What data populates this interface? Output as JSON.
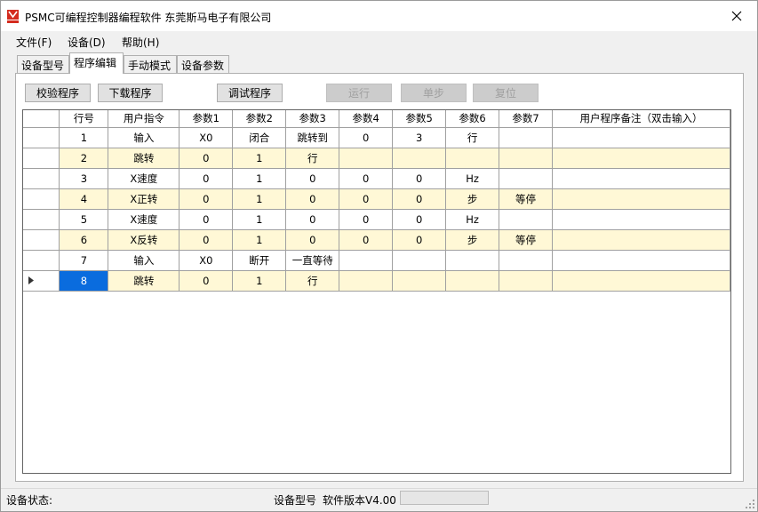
{
  "window": {
    "title": "PSMC可编程控制器编程软件 东莞斯马电子有限公司",
    "accent": "#d42b1e"
  },
  "menu": [
    {
      "label": "文件(F)"
    },
    {
      "label": "设备(D)"
    },
    {
      "label": "帮助(H)"
    }
  ],
  "tabs": [
    {
      "label": "设备型号"
    },
    {
      "label": "程序编辑"
    },
    {
      "label": "手动模式"
    },
    {
      "label": "设备参数"
    }
  ],
  "toolbar": {
    "verify": "校验程序",
    "download": "下载程序",
    "debug": "调试程序",
    "run": "运行",
    "step": "单步",
    "reset": "复位"
  },
  "grid": {
    "headers": [
      "行号",
      "用户指令",
      "参数1",
      "参数2",
      "参数3",
      "参数4",
      "参数5",
      "参数6",
      "参数7",
      "用户程序备注（双击输入）"
    ],
    "rows": [
      [
        "1",
        "输入",
        "X0",
        "闭合",
        "跳转到",
        "0",
        "3",
        "行",
        "",
        ""
      ],
      [
        "2",
        "跳转",
        "0",
        "1",
        "行",
        "",
        "",
        "",
        "",
        ""
      ],
      [
        "3",
        "X速度",
        "0",
        "1",
        "0",
        "0",
        "0",
        "Hz",
        "",
        ""
      ],
      [
        "4",
        "X正转",
        "0",
        "1",
        "0",
        "0",
        "0",
        "步",
        "等停",
        ""
      ],
      [
        "5",
        "X速度",
        "0",
        "1",
        "0",
        "0",
        "0",
        "Hz",
        "",
        ""
      ],
      [
        "6",
        "X反转",
        "0",
        "1",
        "0",
        "0",
        "0",
        "步",
        "等停",
        ""
      ],
      [
        "7",
        "输入",
        "X0",
        "断开",
        "一直等待",
        "",
        "",
        "",
        "",
        ""
      ],
      [
        "8",
        "跳转",
        "0",
        "1",
        "行",
        "",
        "",
        "",
        "",
        ""
      ]
    ],
    "current_row": 8,
    "row_highlight": "#fff8d6",
    "selection_color": "#0a6cde"
  },
  "status": {
    "device_status_label": "设备状态:",
    "device_model_label": "设备型号",
    "software_version": "软件版本V4.00",
    "progress": 0
  }
}
